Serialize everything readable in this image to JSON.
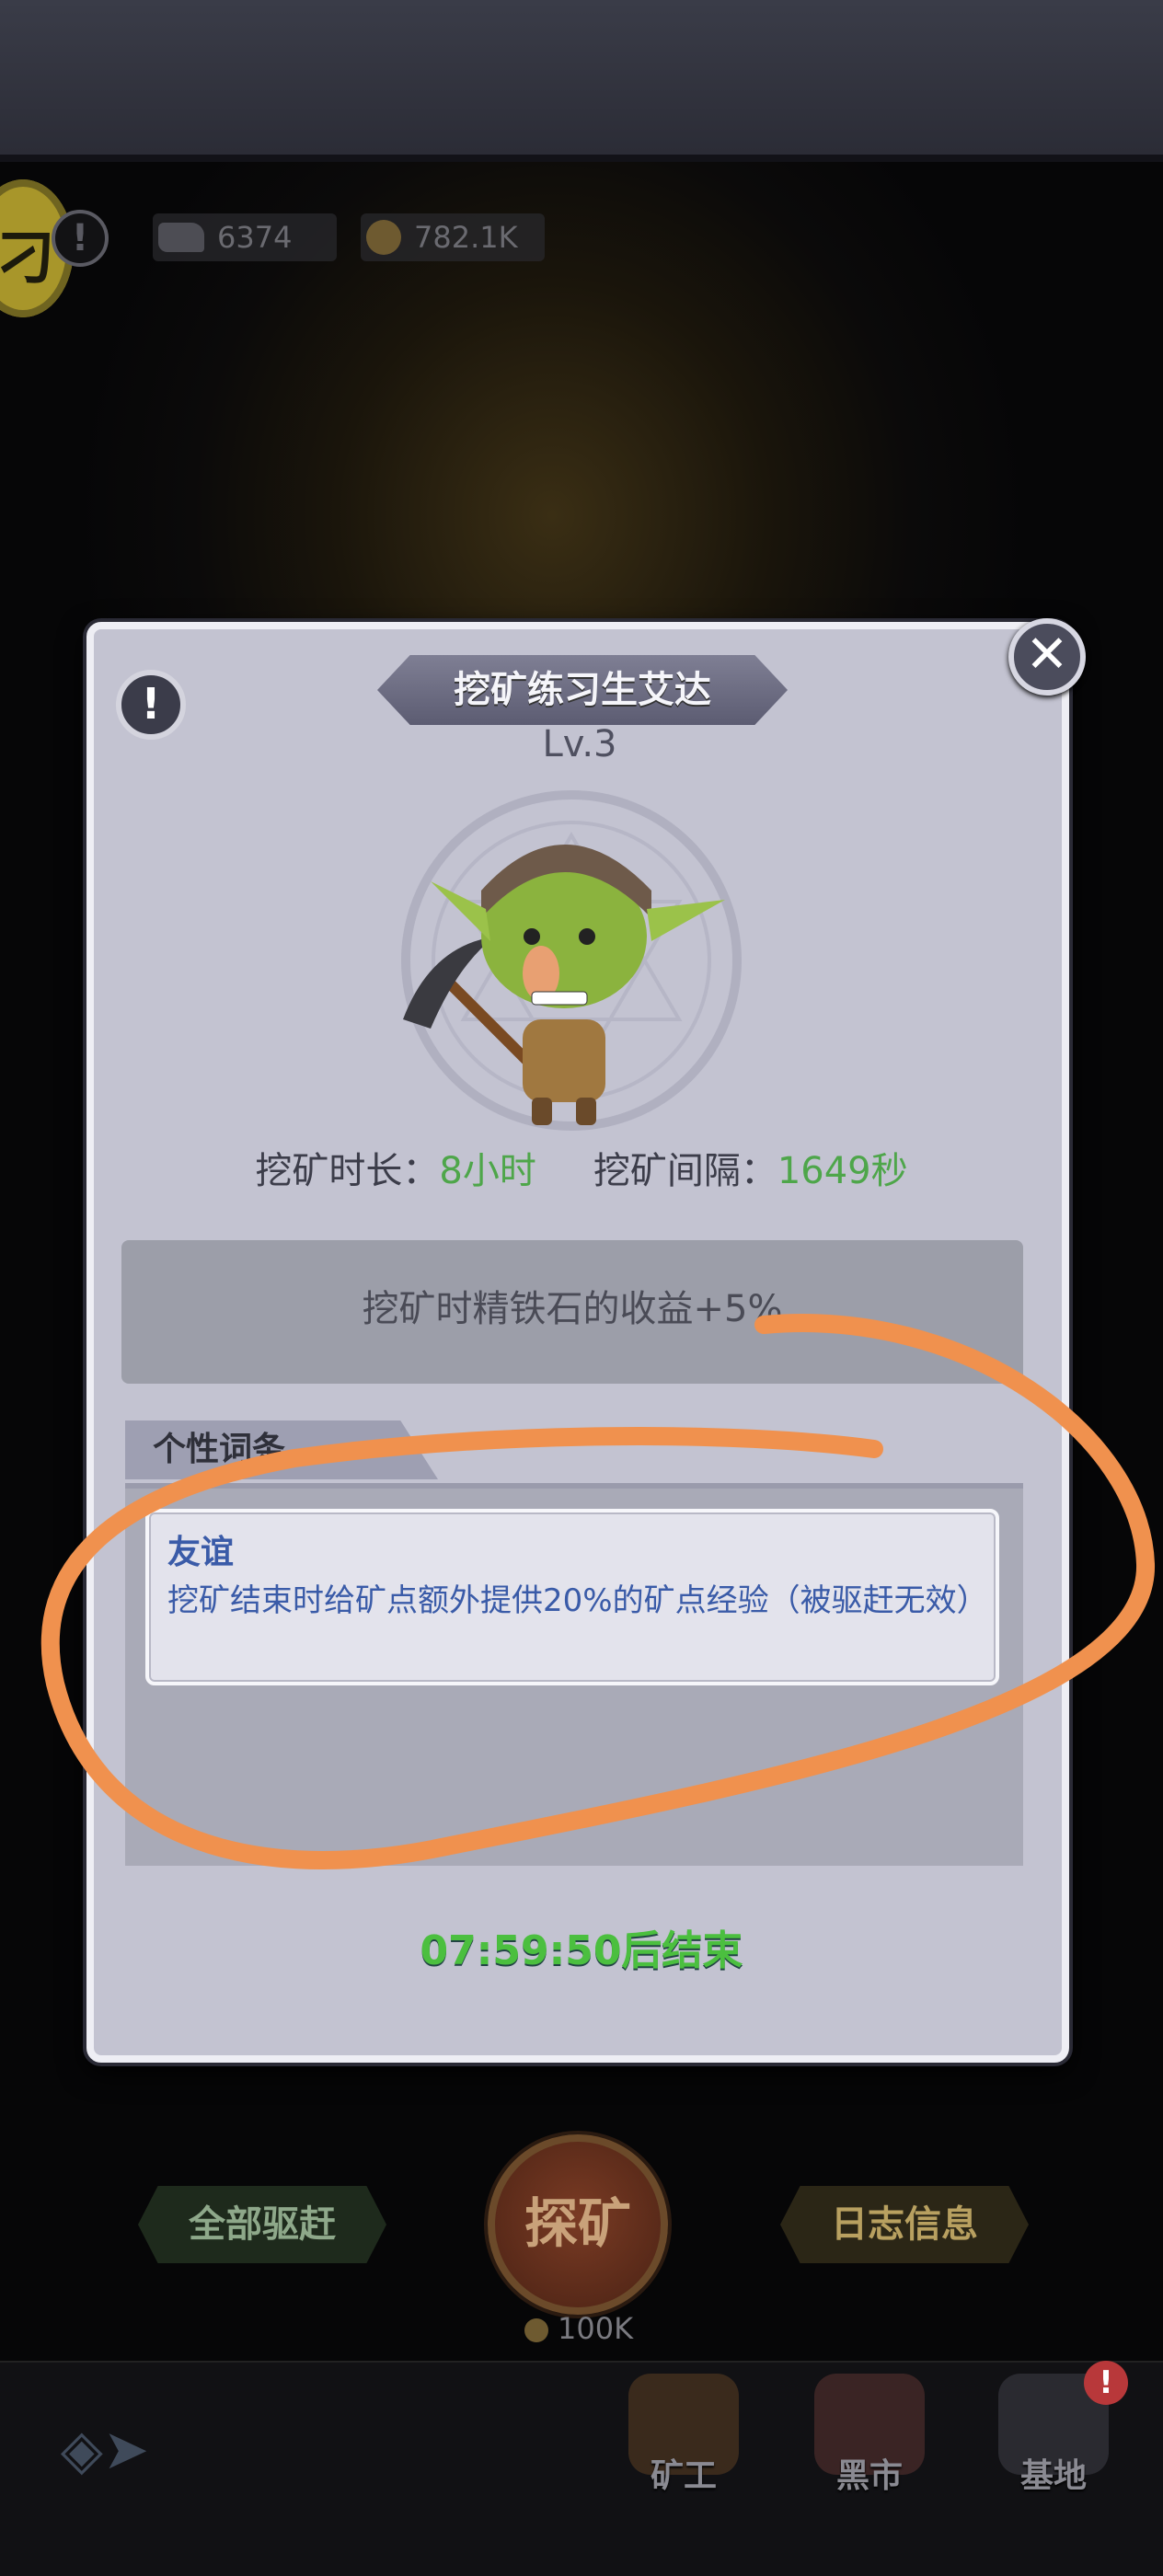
{
  "hud": {
    "badge_glyph": "刁",
    "info_glyph": "!",
    "iron_icon": "iron-ore-icon",
    "iron_value": "6374",
    "gold_icon": "gold-coin-icon",
    "gold_value": "782.1K"
  },
  "modal": {
    "title": "挖矿练习生艾达",
    "level": "Lv.3",
    "close_glyph": "✕",
    "info_glyph": "!",
    "stats": {
      "duration_label": "挖矿时长：",
      "duration_value": "8小时",
      "interval_label": "挖矿间隔：",
      "interval_value": "1649秒"
    },
    "bonus_text": "挖矿时精铁石的收益+5%",
    "trait_section_title": "个性词条",
    "trait": {
      "name": "友谊",
      "description": "挖矿结束时给矿点额外提供20%的矿点经验（被驱赶无效）"
    },
    "timer_text": "07:59:50后结束"
  },
  "actions": {
    "evict_all": "全部驱赶",
    "explore": "探矿",
    "explore_cost": "100K",
    "log_info": "日志信息"
  },
  "nav": {
    "back_glyph": "◈➤",
    "items": [
      {
        "label": "矿工",
        "icon": "miner-icon"
      },
      {
        "label": "黑市",
        "icon": "black-market-icon"
      },
      {
        "label": "基地",
        "icon": "base-icon"
      }
    ],
    "alert_glyph": "!"
  },
  "colors": {
    "accent_green": "#4ea64a",
    "trait_blue": "#3a5ba8",
    "annotation_orange": "#f0914e",
    "modal_bg": "#c3c3d1"
  }
}
